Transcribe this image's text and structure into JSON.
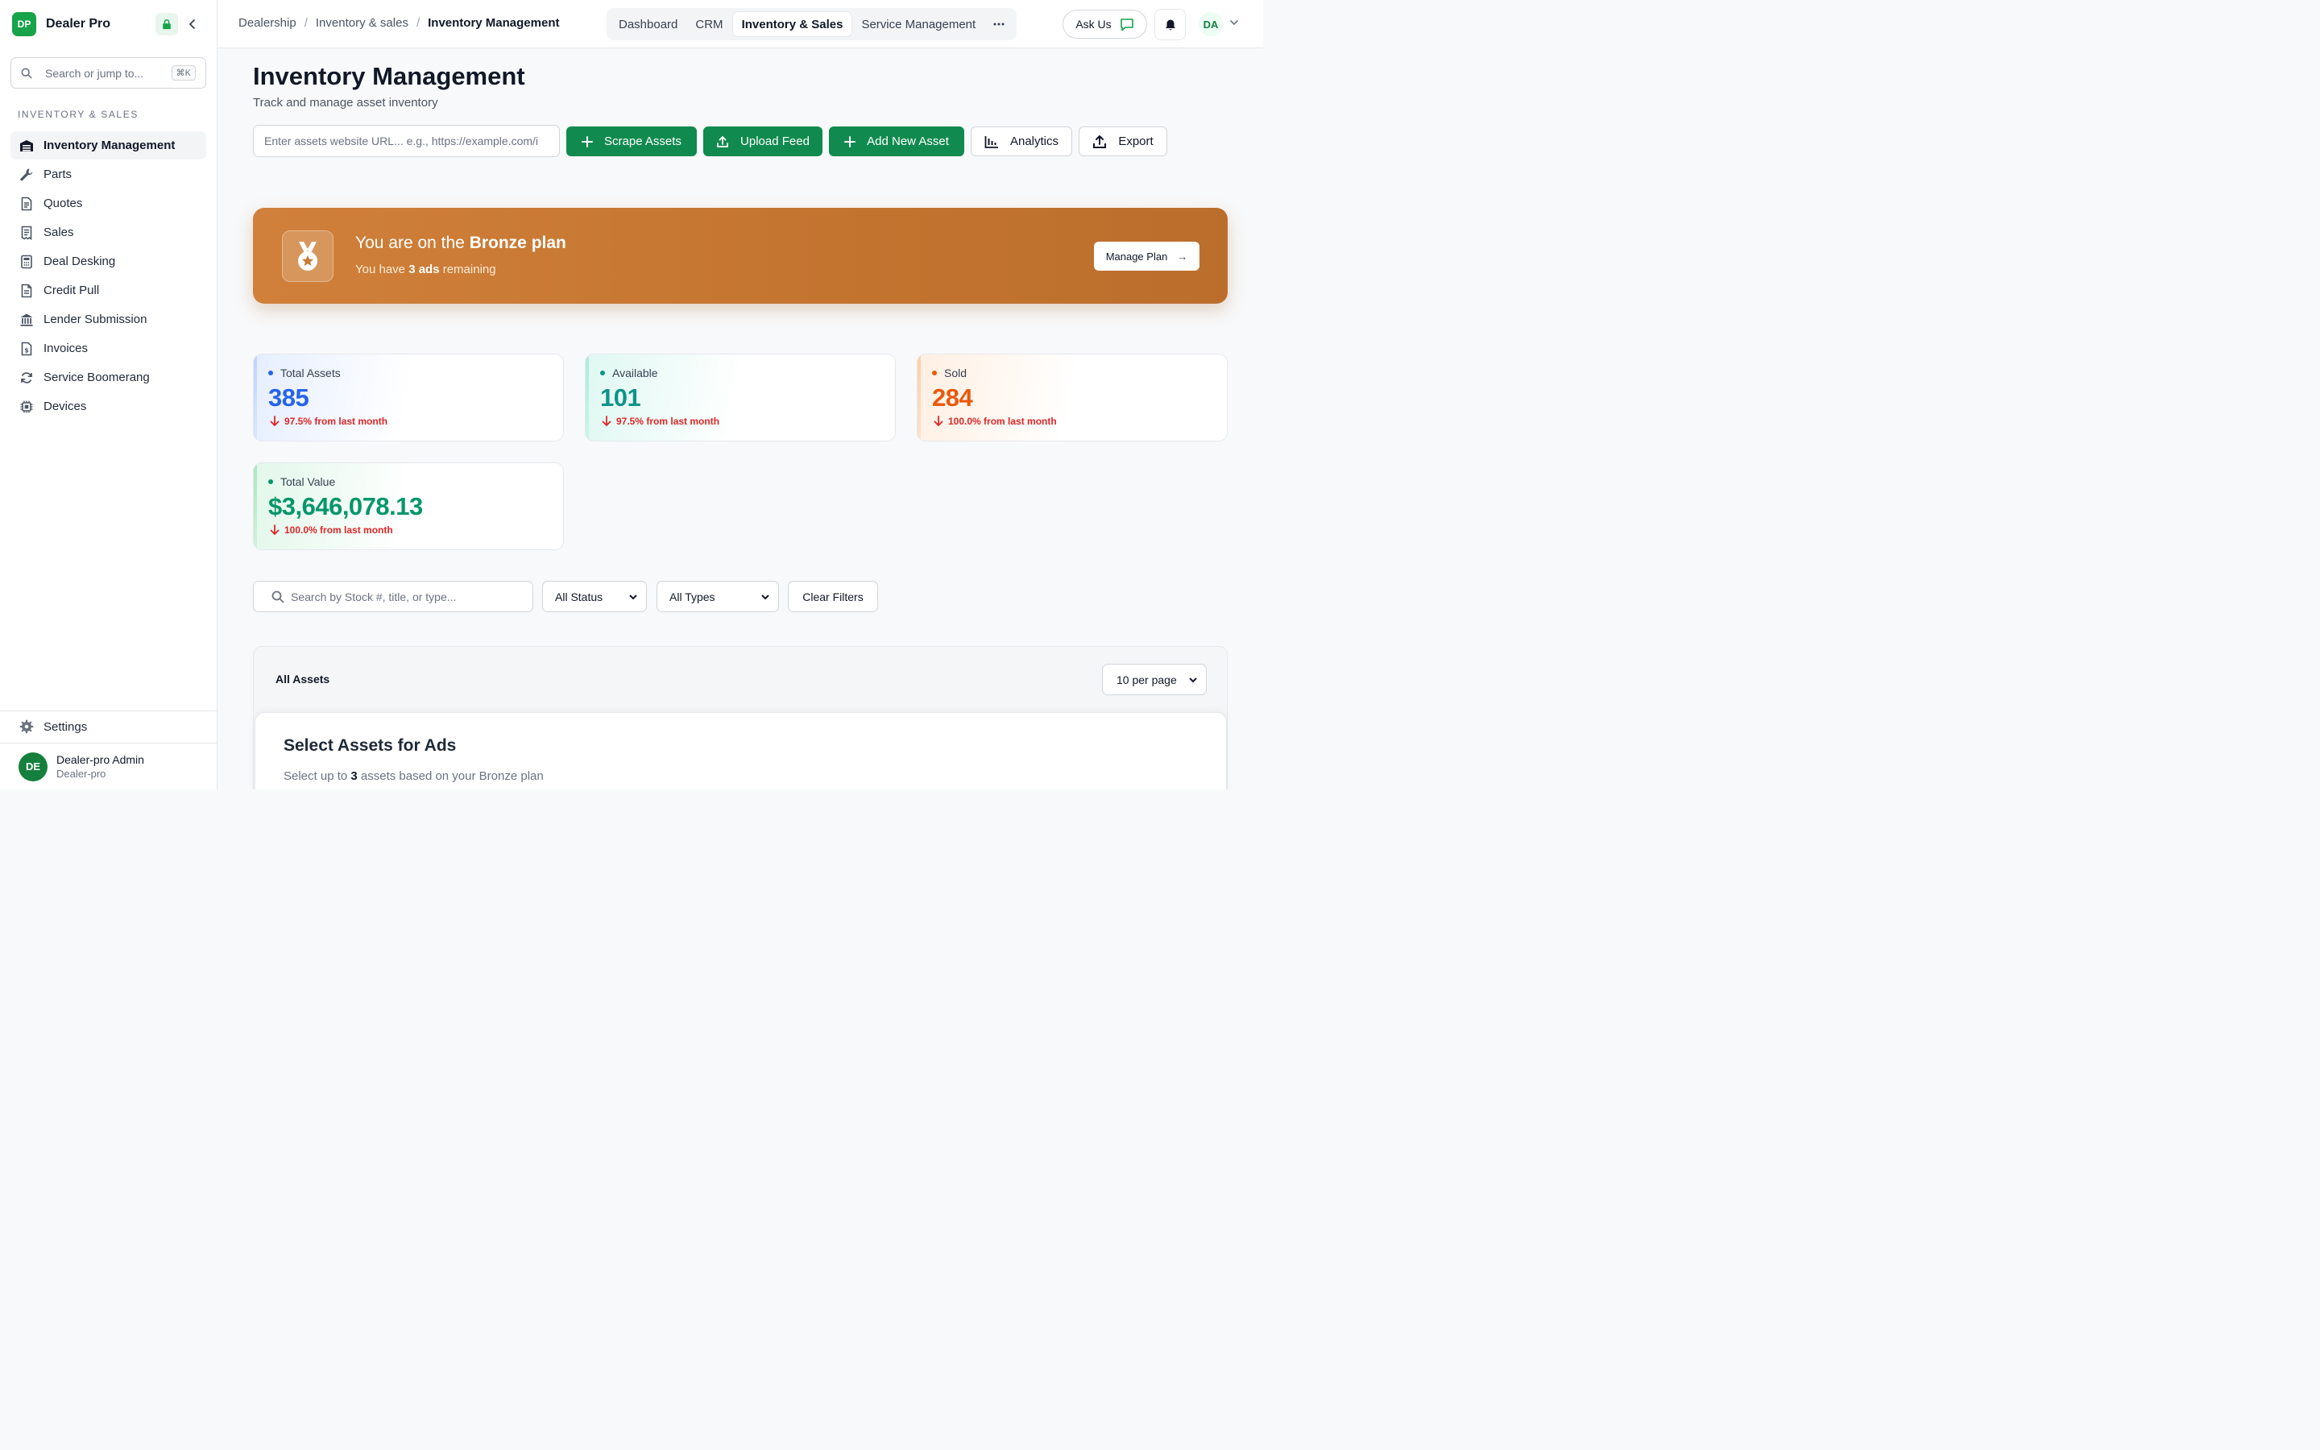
{
  "brand": {
    "initials": "DP",
    "name": "Dealer Pro"
  },
  "sidebar": {
    "search_placeholder": "Search or jump to...",
    "search_shortcut": "⌘K",
    "section_label": "INVENTORY & SALES",
    "items": [
      {
        "label": "Inventory Management",
        "icon": "warehouse-icon"
      },
      {
        "label": "Parts",
        "icon": "wrench-icon"
      },
      {
        "label": "Quotes",
        "icon": "document-icon"
      },
      {
        "label": "Sales",
        "icon": "receipt-icon"
      },
      {
        "label": "Deal Desking",
        "icon": "calculator-icon"
      },
      {
        "label": "Credit Pull",
        "icon": "file-text-icon"
      },
      {
        "label": "Lender Submission",
        "icon": "bank-icon"
      },
      {
        "label": "Invoices",
        "icon": "invoice-icon"
      },
      {
        "label": "Service Boomerang",
        "icon": "refresh-icon"
      },
      {
        "label": "Devices",
        "icon": "chip-icon"
      }
    ],
    "settings_label": "Settings",
    "user": {
      "initials": "DE",
      "name": "Dealer-pro Admin",
      "org": "Dealer-pro"
    }
  },
  "topbar": {
    "breadcrumb": [
      "Dealership",
      "Inventory & sales",
      "Inventory Management"
    ],
    "tabs": [
      "Dashboard",
      "CRM",
      "Inventory & Sales",
      "Service Management"
    ],
    "active_tab": "Inventory & Sales",
    "ask_label": "Ask Us",
    "avatar_initials": "DA"
  },
  "main": {
    "title": "Inventory Management",
    "subtitle": "Track and manage asset inventory",
    "url_placeholder": "Enter assets website URL... e.g., https://example.com/i",
    "buttons": {
      "scrape": "Scrape Assets",
      "upload": "Upload Feed",
      "add": "Add New Asset",
      "analytics": "Analytics",
      "export": "Export"
    },
    "plan": {
      "title_prefix": "You are on the ",
      "plan_name": "Bronze plan",
      "sub_prefix": "You have ",
      "ads_count": "3 ads",
      "sub_suffix": " remaining",
      "manage_label": "Manage Plan",
      "manage_arrow": "→"
    },
    "stats": [
      {
        "label": "Total Assets",
        "value": "385",
        "change": "97.5% from last month",
        "color": "#2563eb"
      },
      {
        "label": "Available",
        "value": "101",
        "change": "97.5% from last month",
        "color": "#0d9488"
      },
      {
        "label": "Sold",
        "value": "284",
        "change": "100.0% from last month",
        "color": "#ea580c"
      },
      {
        "label": "Total Value",
        "value": "$3,646,078.13",
        "change": "100.0% from last month",
        "color": "#059669"
      }
    ],
    "filters": {
      "search_placeholder": "Search by Stock #, title, or type...",
      "status": "All Status",
      "types": "All Types",
      "clear": "Clear Filters"
    },
    "assets": {
      "title": "All Assets",
      "per_page": "10 per page",
      "select_title": "Select Assets for Ads",
      "select_prefix": "Select up to ",
      "select_count": "3",
      "select_suffix": " assets based on your Bronze plan"
    }
  },
  "colors": {
    "primary_green": "#118a4f",
    "plan_bronze": "#c87a34",
    "negative": "#dc2626"
  }
}
